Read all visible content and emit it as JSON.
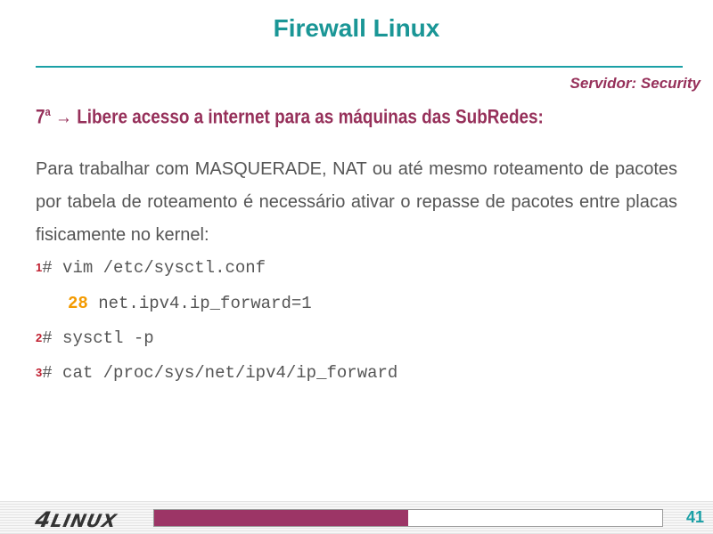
{
  "slide": {
    "title": "Firewall Linux",
    "subtitle": "Servidor: Security",
    "heading": {
      "number": "7",
      "ordinal": "a",
      "text": " → Libere acesso a internet para as máquinas das SubRedes:"
    },
    "paragraph": "Para trabalhar com MASQUERADE, NAT ou até mesmo roteamento de pacotes por tabela de roteamento é necessário ativar o repasse de pacotes entre placas fisicamente no kernel:",
    "commands": [
      {
        "num": "1",
        "text": "# vim /etc/sysctl.conf"
      },
      {
        "line": "28",
        "text": " net.ipv4.ip_forward=1"
      },
      {
        "num": "2",
        "text": "# sysctl -p"
      },
      {
        "num": "3",
        "text": "# cat /proc/sys/net/ipv4/ip_forward"
      }
    ]
  },
  "footer": {
    "logo_four": "4",
    "logo_text": "LINUX",
    "progress_fraction": 0.5,
    "page_number": "41",
    "colors": {
      "accent": "#1aa0a6",
      "brand": "#96305a"
    }
  }
}
